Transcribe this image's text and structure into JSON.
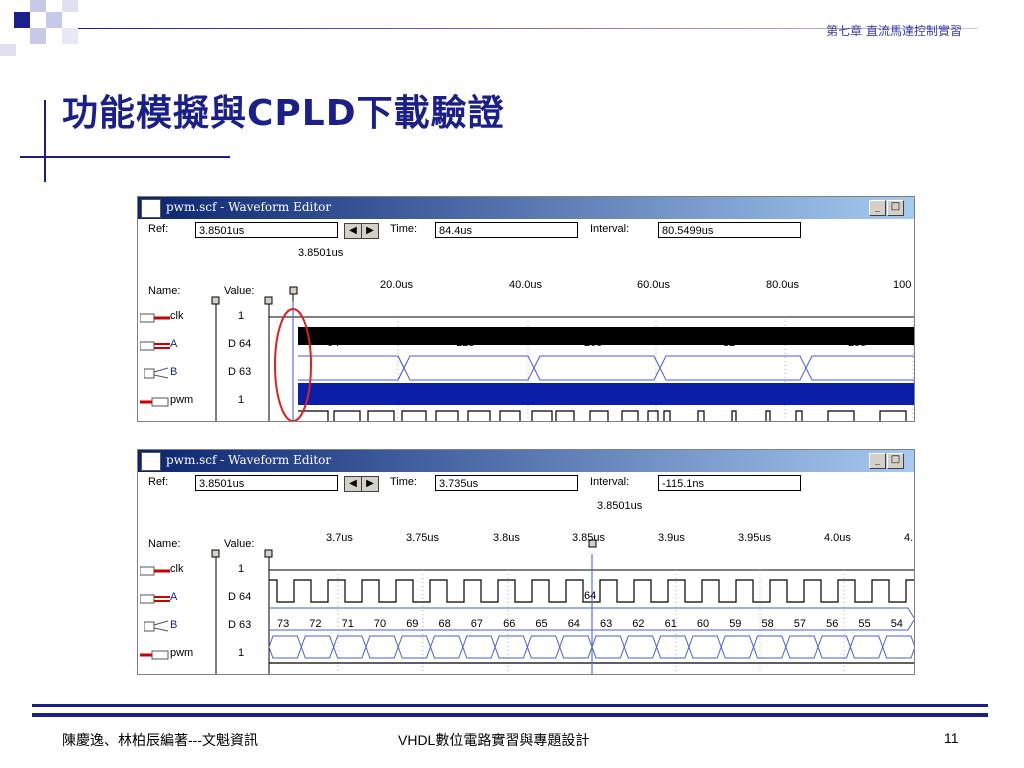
{
  "header": {
    "chapter": "第七章 直流馬達控制實習"
  },
  "slide": {
    "title": "功能模擬與CPLD下載驗證"
  },
  "windows": [
    {
      "title": "pwm.scf - Waveform Editor",
      "ref_label": "Ref:",
      "ref_value": "3.8501us",
      "time_label": "Time:",
      "time_value": "84.4us",
      "interval_label": "Interval:",
      "interval_value": "80.5499us",
      "marker_label": "3.8501us",
      "name_header": "Name:",
      "value_header": "Value:",
      "ticks": [
        "20.0us",
        "40.0us",
        "60.0us",
        "80.0us",
        "100"
      ],
      "signals": [
        {
          "name": "clk",
          "value": "1"
        },
        {
          "name": "A",
          "value": "D 64"
        },
        {
          "name": "B",
          "value": "D 63"
        },
        {
          "name": "pwm",
          "value": "1"
        }
      ],
      "a_bus_values": [
        "64",
        "128",
        "200",
        "32",
        "255"
      ]
    },
    {
      "title": "pwm.scf - Waveform Editor",
      "ref_label": "Ref:",
      "ref_value": "3.8501us",
      "time_label": "Time:",
      "time_value": "3.735us",
      "interval_label": "Interval:",
      "interval_value": "-115.1ns",
      "marker_label": "3.8501us",
      "name_header": "Name:",
      "value_header": "Value:",
      "ticks": [
        "3.7us",
        "3.75us",
        "3.8us",
        "3.85us",
        "3.9us",
        "3.95us",
        "4.0us",
        "4."
      ],
      "signals": [
        {
          "name": "clk",
          "value": "1"
        },
        {
          "name": "A",
          "value": "D 64"
        },
        {
          "name": "B",
          "value": "D 63"
        },
        {
          "name": "pwm",
          "value": "1"
        }
      ],
      "a_bus_values": [
        "64"
      ],
      "b_bus_values": [
        "73",
        "72",
        "71",
        "70",
        "69",
        "68",
        "67",
        "66",
        "65",
        "64",
        "63",
        "62",
        "61",
        "60",
        "59",
        "58",
        "57",
        "56",
        "55",
        "54"
      ]
    }
  ],
  "footer": {
    "authors": "陳慶逸、林柏辰編著---文魁資訊",
    "book": "VHDL數位電路實習與專題設計",
    "page": "11"
  },
  "colors": {
    "accent": "#1b1f8a",
    "bus": "#4a5fd0",
    "fill_blue": "#0a1ea8",
    "marker": "#5a70e0",
    "circle": "#e02020"
  }
}
